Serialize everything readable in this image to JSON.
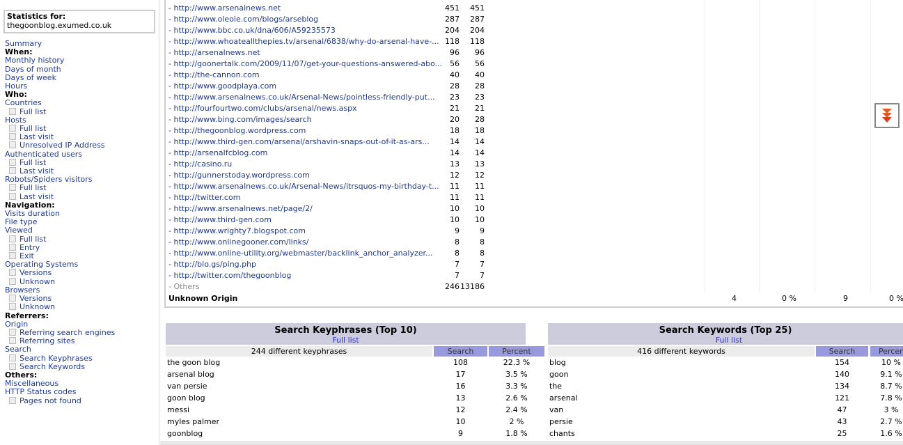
{
  "sidebar": {
    "stats_label": "Statistics for:",
    "site": "thegoonblog.exumed.co.uk",
    "items": [
      {
        "t": "Summary",
        "k": "link"
      },
      {
        "t": "When:",
        "k": "h"
      },
      {
        "t": "Monthly history",
        "k": "link"
      },
      {
        "t": "Days of month",
        "k": "link"
      },
      {
        "t": "Days of week",
        "k": "link"
      },
      {
        "t": "Hours",
        "k": "link"
      },
      {
        "t": "Who:",
        "k": "h"
      },
      {
        "t": "Countries",
        "k": "link"
      },
      {
        "t": "Full list",
        "k": "sub"
      },
      {
        "t": "Hosts",
        "k": "link"
      },
      {
        "t": "Full list",
        "k": "sub"
      },
      {
        "t": "Last visit",
        "k": "sub"
      },
      {
        "t": "Unresolved IP Address",
        "k": "sub"
      },
      {
        "t": "Authenticated users",
        "k": "link"
      },
      {
        "t": "Full list",
        "k": "sub"
      },
      {
        "t": "Last visit",
        "k": "sub"
      },
      {
        "t": "Robots/Spiders visitors",
        "k": "link"
      },
      {
        "t": "Full list",
        "k": "sub"
      },
      {
        "t": "Last visit",
        "k": "sub"
      },
      {
        "t": "Navigation:",
        "k": "h"
      },
      {
        "t": "Visits duration",
        "k": "link"
      },
      {
        "t": "File type",
        "k": "link"
      },
      {
        "t": "Viewed",
        "k": "link"
      },
      {
        "t": "Full list",
        "k": "sub"
      },
      {
        "t": "Entry",
        "k": "sub"
      },
      {
        "t": "Exit",
        "k": "sub"
      },
      {
        "t": "Operating Systems",
        "k": "link"
      },
      {
        "t": "Versions",
        "k": "sub"
      },
      {
        "t": "Unknown",
        "k": "sub"
      },
      {
        "t": "Browsers",
        "k": "link"
      },
      {
        "t": "Versions",
        "k": "sub"
      },
      {
        "t": "Unknown",
        "k": "sub"
      },
      {
        "t": "Referrers:",
        "k": "h"
      },
      {
        "t": "Origin",
        "k": "link"
      },
      {
        "t": "Referring search engines",
        "k": "sub"
      },
      {
        "t": "Referring sites",
        "k": "sub"
      },
      {
        "t": "Search",
        "k": "link"
      },
      {
        "t": "Search Keyphrases",
        "k": "sub"
      },
      {
        "t": "Search Keywords",
        "k": "sub"
      },
      {
        "t": "Others:",
        "k": "h"
      },
      {
        "t": "Miscellaneous",
        "k": "link"
      },
      {
        "t": "HTTP Status codes",
        "k": "link"
      },
      {
        "t": "Pages not found",
        "k": "sub"
      }
    ]
  },
  "referrers": {
    "rows": [
      [
        "- http://www.arsenalnews.net",
        "451",
        "451"
      ],
      [
        "- http://www.oleole.com/blogs/arseblog",
        "287",
        "287"
      ],
      [
        "- http://www.bbc.co.uk/dna/606/A59235573",
        "204",
        "204"
      ],
      [
        "- http://www.whoateallthepies.tv/arsenal/6838/why-do-arsenal-have-...",
        "118",
        "118"
      ],
      [
        "- http://arsenalnews.net",
        "96",
        "96"
      ],
      [
        "- http://goonertalk.com/2009/11/07/get-your-questions-answered-abo...",
        "56",
        "56"
      ],
      [
        "- http://the-cannon.com",
        "40",
        "40"
      ],
      [
        "- http://www.goodplaya.com",
        "28",
        "28"
      ],
      [
        "- http://www.arsenalnews.co.uk/Arsenal-News/pointless-friendly-put...",
        "23",
        "23"
      ],
      [
        "- http://fourfourtwo.com/clubs/arsenal/news.aspx",
        "21",
        "21"
      ],
      [
        "- http://www.bing.com/images/search",
        "20",
        "28"
      ],
      [
        "- http://thegoonblog.wordpress.com",
        "18",
        "18"
      ],
      [
        "- http://www.third-gen.com/arsenal/arshavin-snaps-out-of-it-as-ars...",
        "14",
        "14"
      ],
      [
        "- http://arsenalfcblog.com",
        "14",
        "14"
      ],
      [
        "- http://casino.ru",
        "13",
        "13"
      ],
      [
        "- http://gunnerstoday.wordpress.com",
        "12",
        "12"
      ],
      [
        "- http://www.arsenalnews.co.uk/Arsenal-News/itrsquos-my-birthday-t...",
        "11",
        "11"
      ],
      [
        "- http://twitter.com",
        "11",
        "11"
      ],
      [
        "- http://www.arsenalnews.net/page/2/",
        "10",
        "10"
      ],
      [
        "- http://www.third-gen.com",
        "10",
        "10"
      ],
      [
        "- http://www.wrighty7.blogspot.com",
        "9",
        "9"
      ],
      [
        "- http://www.onlinegooner.com/links/",
        "8",
        "8"
      ],
      [
        "- http://www.online-utility.org/webmaster/backlink_anchor_analyzer...",
        "8",
        "8"
      ],
      [
        "- http://blo.gs/ping.php",
        "7",
        "7"
      ],
      [
        "- http://twitter.com/thegoonblog",
        "7",
        "7"
      ]
    ],
    "others": {
      "label": "- Others",
      "n1": "246",
      "n2": "13186"
    },
    "unknown": {
      "label": "Unknown Origin",
      "v1": "4",
      "v2": "0 %",
      "v3": "9",
      "v4": "0 %"
    }
  },
  "keyphrases": {
    "title": "Search Keyphrases (Top 10)",
    "full_list": "Full list",
    "count_label": "244 different keyphrases",
    "col_search": "Search",
    "col_percent": "Percent",
    "rows": [
      [
        "the goon blog",
        "108",
        "22.3 %"
      ],
      [
        "arsenal blog",
        "17",
        "3.5 %"
      ],
      [
        "van persie",
        "16",
        "3.3 %"
      ],
      [
        "goon blog",
        "13",
        "2.6 %"
      ],
      [
        "messi",
        "12",
        "2.4 %"
      ],
      [
        "myles palmer",
        "10",
        "2 %"
      ],
      [
        "goonblog",
        "9",
        "1.8 %"
      ]
    ]
  },
  "keywords": {
    "title": "Search Keywords (Top 25)",
    "full_list": "Full list",
    "count_label": "416 different keywords",
    "col_search": "Search",
    "col_percent": "Percent",
    "rows": [
      [
        "blog",
        "154",
        "10 %"
      ],
      [
        "goon",
        "140",
        "9.1 %"
      ],
      [
        "the",
        "134",
        "8.7 %"
      ],
      [
        "arsenal",
        "121",
        "7.8 %"
      ],
      [
        "van",
        "47",
        "3 %"
      ],
      [
        "persie",
        "43",
        "2.7 %"
      ],
      [
        "chants",
        "25",
        "1.6 %"
      ]
    ]
  },
  "colors": {
    "header_bg": "#ccccdd",
    "col_header": "#9999dd",
    "link": "#1f3a8f",
    "download_arrow": "#e05a2a"
  }
}
